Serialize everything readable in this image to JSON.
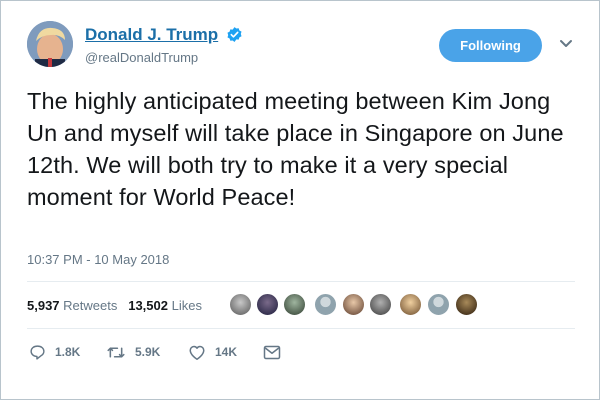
{
  "user": {
    "display_name": "Donald J. Trump",
    "handle": "@realDonaldTrump",
    "verified": true,
    "follow_label": "Following"
  },
  "tweet": {
    "text": "The highly anticipated meeting between Kim Jong Un and myself will take place in Singapore on June 12th. We will both try to make it a very special moment for World Peace!",
    "timestamp": "10:37 PM - 10 May 2018"
  },
  "stats": {
    "retweets_count": "5,937",
    "retweets_label": "Retweets",
    "likes_count": "13,502",
    "likes_label": "Likes",
    "liker_avatar_count": 9
  },
  "actions": {
    "reply_count": "1.8K",
    "retweet_count": "5.9K",
    "like_count": "14K"
  },
  "colors": {
    "accent": "#1b6fa8",
    "follow_button": "#4aa3e8",
    "muted_text": "#657786",
    "verified_badge": "#1da1f2"
  },
  "icons": {
    "verified": "verified-badge-icon",
    "caret": "chevron-down-icon",
    "reply": "reply-icon",
    "retweet": "retweet-icon",
    "like": "heart-icon",
    "dm": "envelope-icon"
  }
}
